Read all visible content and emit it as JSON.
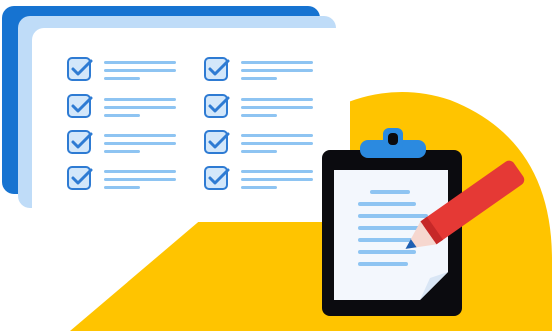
{
  "colors": {
    "background": "#ffffff",
    "yellow_blob": "#FFC400",
    "card_back": "#1673D1",
    "card_middle": "#BFDCF8",
    "card_front": "#FFFFFF",
    "checkbox_fill": "#D3E7FA",
    "checkbox_stroke": "#2E7BD3",
    "text_line": "#8EC4F2",
    "clipboard_board": "#0B0B0F",
    "clipboard_clip": "#2B8AE0",
    "paper": "#F3F7FD",
    "paper_fold": "#D9E6F5",
    "pencil_body": "#E53935",
    "pencil_tip_wood": "#F6D7CF",
    "pencil_tip_lead": "#1E5FB3"
  },
  "icons": {
    "checklist_card": "checklist-card-icon",
    "checkbox": "checked-checkbox-icon",
    "clipboard": "clipboard-icon",
    "pencil": "pencil-icon"
  }
}
